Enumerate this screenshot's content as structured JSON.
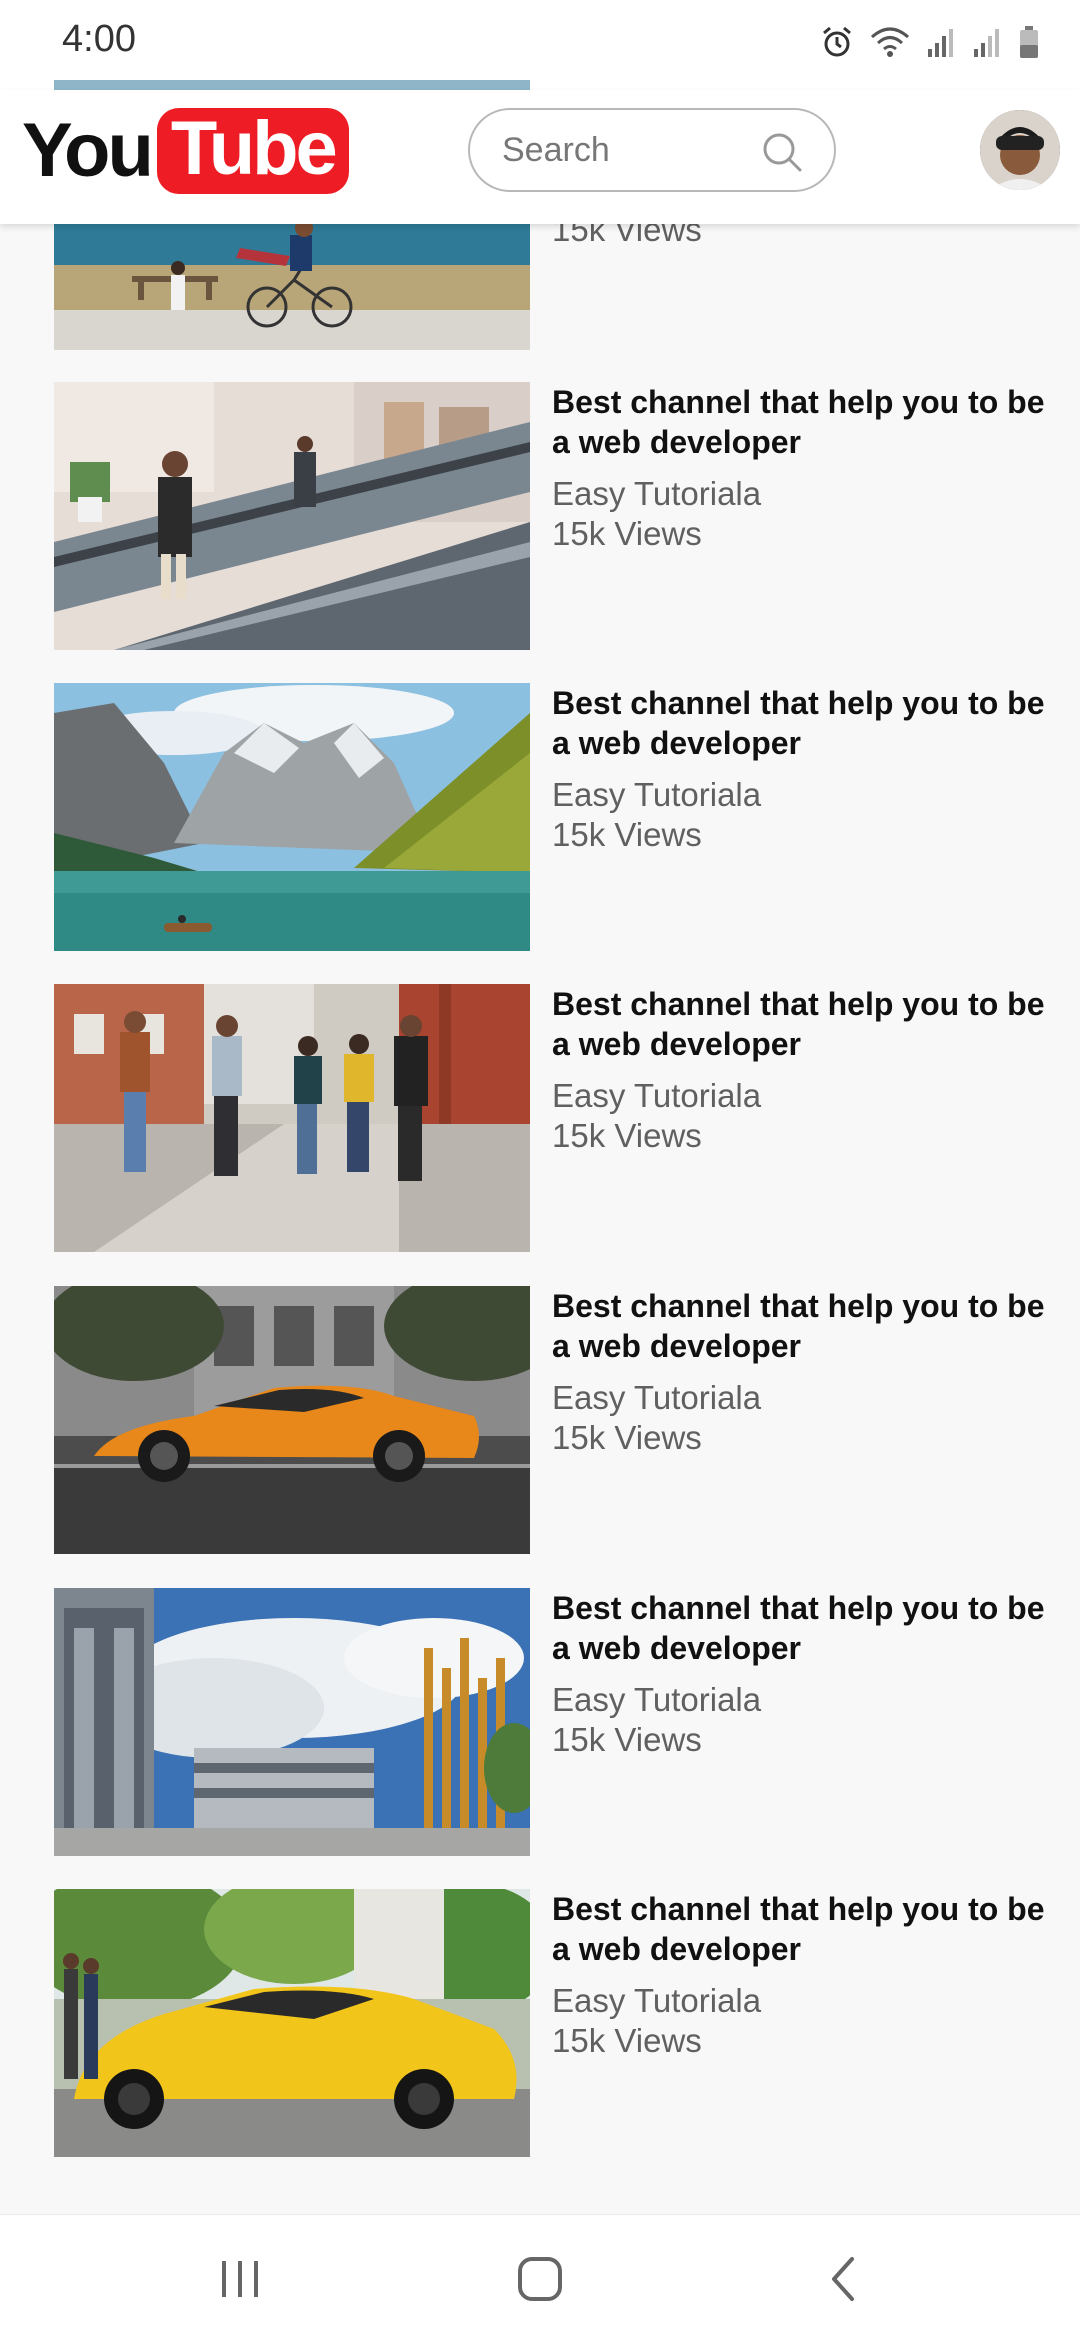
{
  "status_bar": {
    "time": "4:00",
    "icons": [
      "alarm-icon",
      "wifi-icon",
      "signal-icon",
      "signal-icon",
      "battery-icon"
    ]
  },
  "header": {
    "logo_you": "You",
    "logo_tube": "Tube",
    "search_placeholder": "Search",
    "colors": {
      "brand_red": "#ee1c24"
    }
  },
  "partial_item": {
    "views": "15k Views"
  },
  "videos": [
    {
      "title": "Best channel that help you to be a web developer",
      "channel": "Easy Tutoriala",
      "views": "15k Views",
      "thumbnail": "escalator-shopping"
    },
    {
      "title": "Best channel that help you to be a web developer",
      "channel": "Easy Tutoriala",
      "views": "15k Views",
      "thumbnail": "mountain-lake"
    },
    {
      "title": "Best channel that help you to be a web developer",
      "channel": "Easy Tutoriala",
      "views": "15k Views",
      "thumbnail": "friends-walking"
    },
    {
      "title": "Best channel that help you to be a web developer",
      "channel": "Easy Tutoriala",
      "views": "15k Views",
      "thumbnail": "orange-sports-car"
    },
    {
      "title": "Best channel that help you to be a web developer",
      "channel": "Easy Tutoriala",
      "views": "15k Views",
      "thumbnail": "campus-buildings"
    },
    {
      "title": "Best channel that help you to be a web developer",
      "channel": "Easy Tutoriala",
      "views": "15k Views",
      "thumbnail": "yellow-sports-car"
    }
  ],
  "nav": [
    "recent-apps-icon",
    "home-icon",
    "back-icon"
  ]
}
